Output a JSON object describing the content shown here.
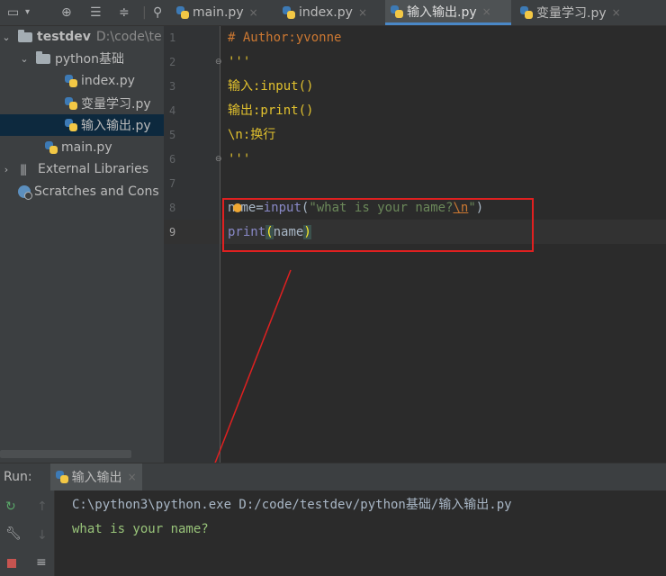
{
  "toolbar": {
    "icons": [
      "project-view-icon",
      "dropdown-icon",
      "target-icon",
      "expand-all-icon",
      "collapse-all-icon",
      "pin-icon"
    ]
  },
  "tabs": [
    {
      "label": "main.py",
      "active": false
    },
    {
      "label": "index.py",
      "active": false
    },
    {
      "label": "输入输出.py",
      "active": true
    },
    {
      "label": "变量学习.py",
      "active": false
    }
  ],
  "tab_close": "×",
  "project": {
    "root_name": "testdev",
    "root_path": "D:\\code\\te",
    "folder": "python基础",
    "files": [
      "index.py",
      "变量学习.py",
      "输入输出.py"
    ],
    "root_file": "main.py",
    "external_libs": "External Libraries",
    "scratches": "Scratches and Cons"
  },
  "editor": {
    "line_numbers": [
      "1",
      "2",
      "3",
      "4",
      "5",
      "6",
      "7",
      "8",
      "9"
    ],
    "line1": "# Author:yvonne",
    "line2": "'''",
    "line3": "输入:input()",
    "line4": "输出:print()",
    "line5": "\\n:换行",
    "line6": "'''",
    "line8_a": "n",
    "line8_b": "me=",
    "line8_func": "input",
    "line8_open": "(",
    "line8_str": "\"what is your name?",
    "line8_esc": "\\n",
    "line8_strend": "\"",
    "line8_close": ")",
    "line9_func": "print",
    "line9_open": "(",
    "line9_arg": "name",
    "line9_close": ")"
  },
  "run": {
    "label": "Run:",
    "tab": "输入输出",
    "close": "×",
    "command": "C:\\python3\\python.exe D:/code/testdev/python基础/输入输出.py",
    "output": "what is your name?"
  },
  "colors": {
    "annotation": "#e02020",
    "accent": "#4a88c7"
  }
}
